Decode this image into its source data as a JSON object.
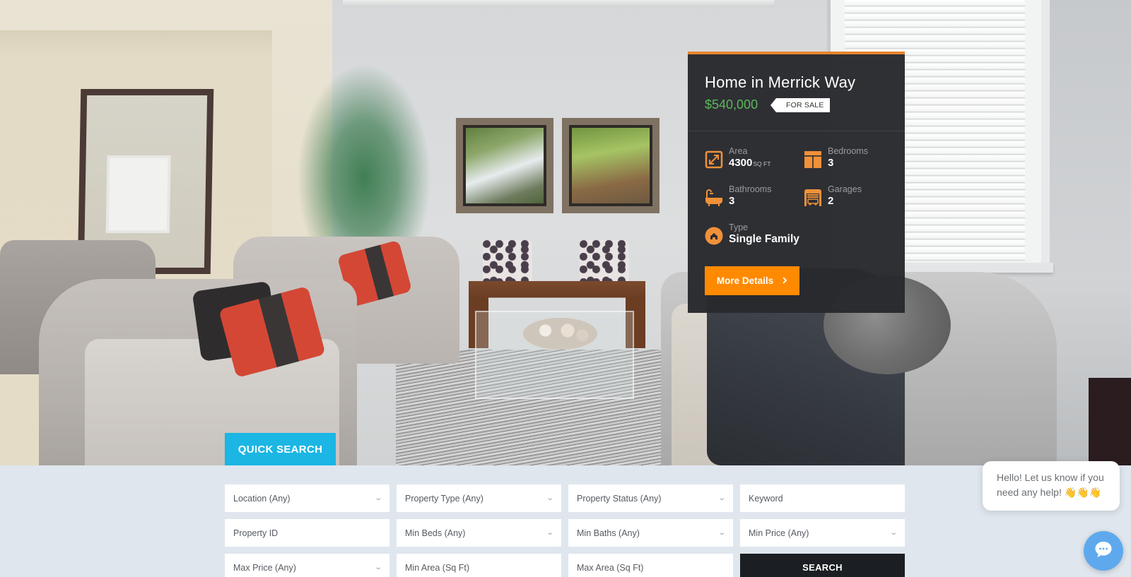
{
  "hero": {
    "scene": "living-room-photo"
  },
  "property_card": {
    "title": "Home in Merrick Way",
    "price": "$540,000",
    "status": "FOR SALE",
    "accent_color": "#e6852e",
    "price_color": "#5cb85c",
    "features": {
      "area": {
        "label": "Area",
        "value": "4300",
        "unit": "SQ FT",
        "icon": "area-icon"
      },
      "bedrooms": {
        "label": "Bedrooms",
        "value": "3",
        "icon": "bed-icon"
      },
      "bathrooms": {
        "label": "Bathrooms",
        "value": "3",
        "icon": "bathtub-icon"
      },
      "garages": {
        "label": "Garages",
        "value": "2",
        "icon": "garage-icon"
      },
      "type": {
        "label": "Type",
        "value": "Single Family",
        "icon": "home-icon"
      }
    },
    "more_button": {
      "label": "More Details",
      "icon": "chevron-right-icon",
      "color": "#ff8a00"
    }
  },
  "quick_search": {
    "tab_label": "QUICK SEARCH",
    "tab_color": "#1bb6e3",
    "fields": {
      "location": "Location (Any)",
      "property_type": "Property Type (Any)",
      "property_status": "Property Status (Any)",
      "keyword_placeholder": "Keyword",
      "property_id_placeholder": "Property ID",
      "min_beds": "Min Beds (Any)",
      "min_baths": "Min Baths (Any)",
      "min_price": "Min Price (Any)",
      "max_price": "Max Price (Any)",
      "min_area_placeholder": "Min Area (Sq Ft)",
      "max_area_placeholder": "Max Area (Sq Ft)"
    },
    "search_button": "SEARCH"
  },
  "chat": {
    "message": "Hello! Let us know if you need any help! 👋👋👋",
    "button_icon": "chat-icon",
    "button_color": "#5ea9ee"
  }
}
